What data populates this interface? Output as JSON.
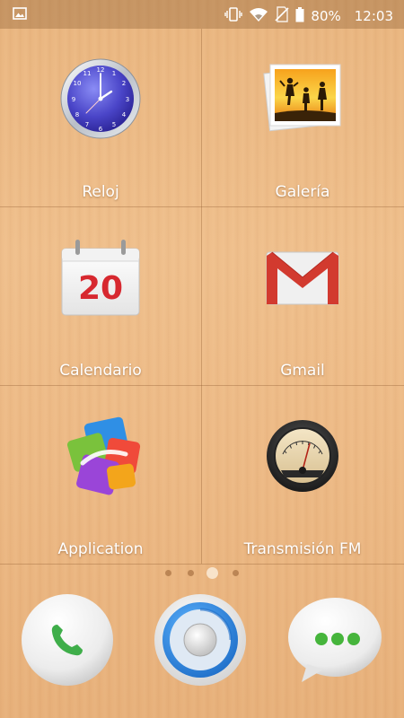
{
  "status_bar": {
    "battery": "80%",
    "time": "12:03",
    "icons": [
      "image-notification-icon",
      "vibrate-icon",
      "wifi-icon",
      "no-sim-icon",
      "battery-icon"
    ]
  },
  "apps": [
    {
      "label": "Reloj",
      "icon": "clock-icon"
    },
    {
      "label": "Galería",
      "icon": "gallery-icon"
    },
    {
      "label": "Calendario",
      "icon": "calendar-icon",
      "date": "20"
    },
    {
      "label": "Gmail",
      "icon": "gmail-icon"
    },
    {
      "label": "Application",
      "icon": "application-icon"
    },
    {
      "label": "Transmisión FM",
      "icon": "fm-radio-icon"
    }
  ],
  "page_indicator": {
    "pages": 4,
    "current": 3
  },
  "dock": [
    {
      "icon": "phone-icon"
    },
    {
      "icon": "home-launcher-icon"
    },
    {
      "icon": "messages-icon"
    }
  ]
}
